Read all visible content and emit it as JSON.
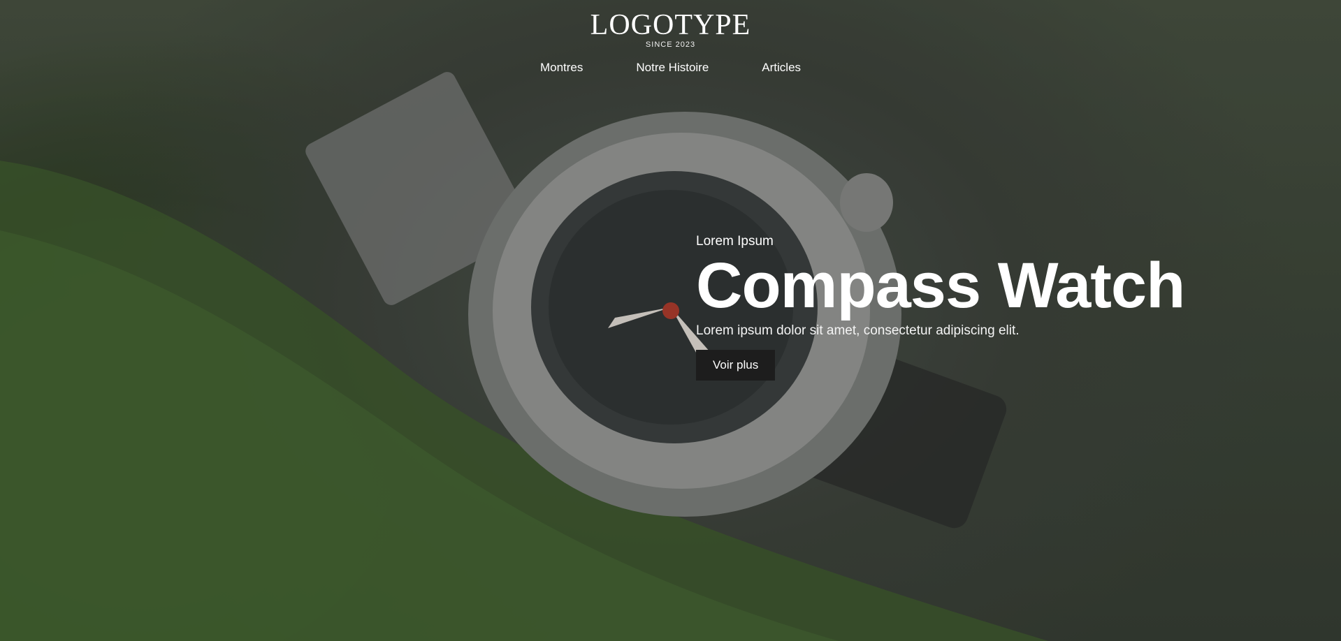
{
  "header": {
    "logo_text": "LOGOTYPE",
    "logo_since": "SINCE 2023"
  },
  "nav": {
    "items": [
      {
        "label": "Montres"
      },
      {
        "label": "Notre Histoire"
      },
      {
        "label": "Articles"
      }
    ]
  },
  "hero": {
    "eyebrow": "Lorem Ipsum",
    "title": "Compass Watch",
    "subtitle": "Lorem ipsum dolor sit amet, consectetur adipiscing elit.",
    "cta_label": "Voir plus",
    "background_image": "watch-on-moss-photo"
  },
  "colors": {
    "overlay": "#2e352c",
    "button_bg": "#1d1d1d",
    "text": "#ffffff"
  }
}
